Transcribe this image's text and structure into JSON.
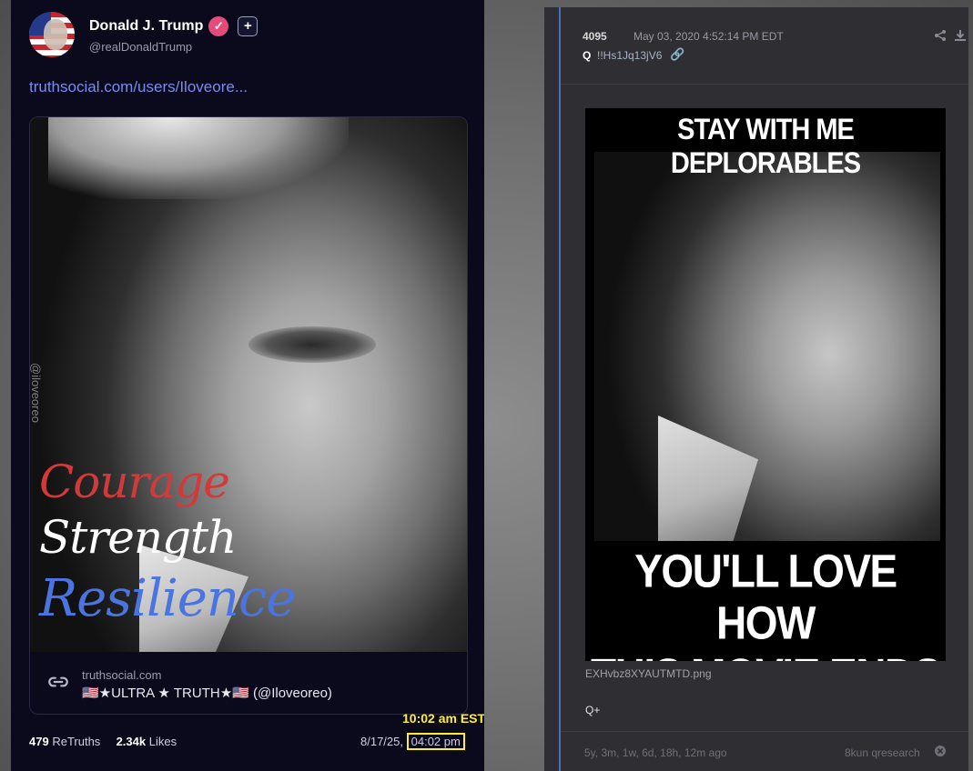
{
  "left": {
    "display_name": "Donald J. Trump",
    "verified_glyph": "✓",
    "plus_glyph": "+",
    "handle": "@realDonaldTrump",
    "link_text": "truthsocial.com/users/Iloveore...",
    "card": {
      "watermark": "@iloveoreo",
      "words": [
        "Courage",
        "Strength",
        "Resilience"
      ],
      "preview_domain": "truthsocial.com",
      "preview_title": "🇺🇸★ULTRA ★ TRUTH★🇺🇸 (@Iloveoreo)"
    },
    "annotation_time": "10:02 am EST",
    "retruths_count": "479",
    "retruths_label": "ReTruths",
    "likes_count": "2.34k",
    "likes_label": "Likes",
    "date": "8/17/25,",
    "time": "04:02 pm"
  },
  "right": {
    "post_number": "4095",
    "post_time": "May 03, 2020 4:52:14 PM EDT",
    "author": "Q",
    "tripcode": "!!Hs1Jq13jV6",
    "meme_top": "STAY WITH ME DEPLORABLES",
    "meme_bottom_line1": "YOU'LL LOVE HOW",
    "meme_bottom_line2": "THIS MOVIE ENDS",
    "filename": "EXHvbz8XYAUTMTD.png",
    "body": "Q+",
    "age": "5y, 3m, 1w, 6d, 18h, 12m ago",
    "board": "8kun qresearch"
  },
  "icons": {
    "link": "link-icon",
    "share": "share-icon",
    "download": "download-icon",
    "chain": "chain-link-icon",
    "close": "close-icon"
  },
  "colors": {
    "left_bg": "#0a0a1c",
    "link": "#7a8cf0",
    "verified": "#e54b7a",
    "highlight": "#ffef2e",
    "right_bg": "#2f2f33",
    "thread_line": "#4b6fc0",
    "courage": "#d23a3a",
    "resilience": "#4a74e0"
  }
}
